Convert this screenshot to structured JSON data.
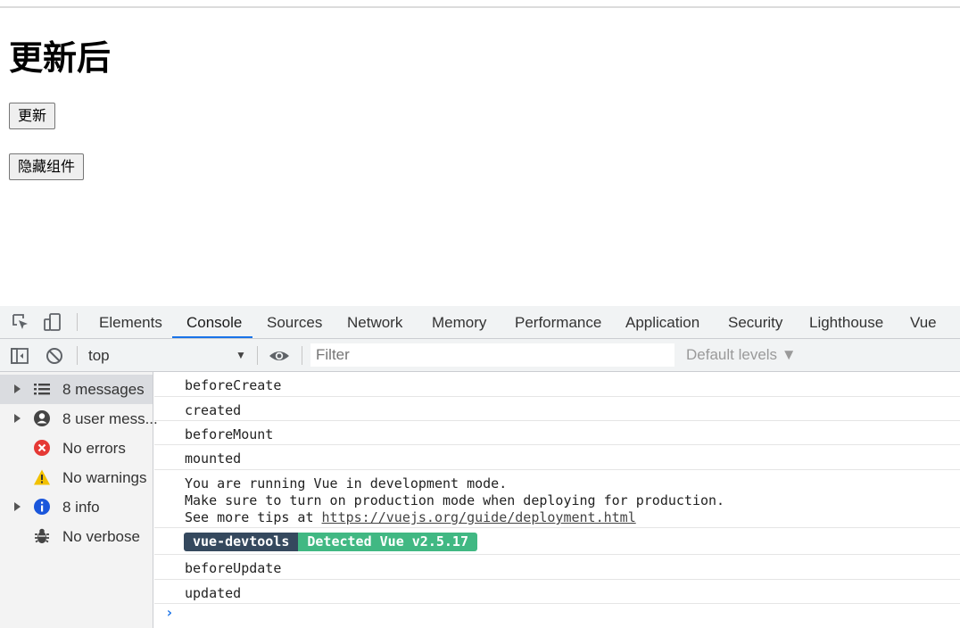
{
  "page": {
    "title": "更新后",
    "update_button": "更新",
    "hide_button": "隐藏组件"
  },
  "devtools": {
    "tabs": [
      {
        "label": "Elements"
      },
      {
        "label": "Console",
        "active": true
      },
      {
        "label": "Sources"
      },
      {
        "label": "Network"
      },
      {
        "label": "Memory"
      },
      {
        "label": "Performance"
      },
      {
        "label": "Application"
      },
      {
        "label": "Security"
      },
      {
        "label": "Lighthouse"
      },
      {
        "label": "Vue"
      }
    ],
    "toolbar": {
      "context": "top",
      "filter_placeholder": "Filter",
      "levels": "Default levels ▼"
    },
    "sidebar": [
      {
        "label": "8 messages",
        "icon": "list-icon",
        "expandable": true,
        "selected": true
      },
      {
        "label": "8 user mess...",
        "icon": "user-icon",
        "expandable": true
      },
      {
        "label": "No errors",
        "icon": "error-icon"
      },
      {
        "label": "No warnings",
        "icon": "warning-icon"
      },
      {
        "label": "8 info",
        "icon": "info-icon",
        "expandable": true
      },
      {
        "label": "No verbose",
        "icon": "bug-icon"
      }
    ],
    "console": {
      "messages": [
        "beforeCreate",
        "created",
        "beforeMount",
        "mounted",
        "You are running Vue in development mode.",
        "Make sure to turn on production mode when deploying for production.",
        "See more tips at ",
        "https://vuejs.org/guide/deployment.html",
        "beforeUpdate",
        "updated"
      ],
      "badge_left": "vue-devtools",
      "badge_right": "Detected Vue v2.5.17"
    },
    "colors": {
      "accent": "#1a73e8",
      "vue_dark": "#35495e",
      "vue_green": "#41b883",
      "error": "#e53935",
      "warning": "#f2c100",
      "info": "#1a56db"
    }
  }
}
